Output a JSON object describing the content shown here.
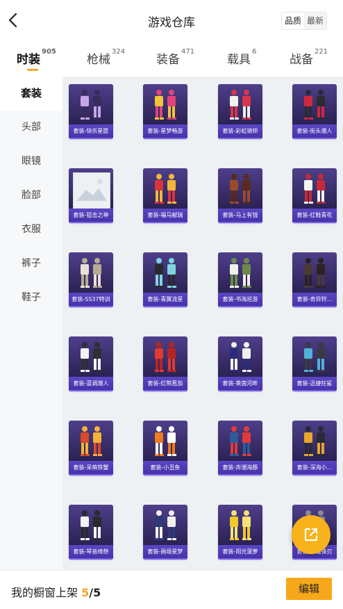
{
  "header": {
    "title": "游戏仓库",
    "sort_options": [
      "品质",
      "最新"
    ],
    "active_sort": "品质"
  },
  "tabs": [
    {
      "label": "时装",
      "count": "905",
      "active": true
    },
    {
      "label": "枪械",
      "count": "324",
      "active": false
    },
    {
      "label": "装备",
      "count": "471",
      "active": false
    },
    {
      "label": "载具",
      "count": "6",
      "active": false
    },
    {
      "label": "战备",
      "count": "221",
      "active": false
    }
  ],
  "sidebar": {
    "items": [
      "套装",
      "头部",
      "眼镜",
      "脸部",
      "衣服",
      "裤子",
      "鞋子"
    ],
    "active": "套装"
  },
  "items": [
    {
      "name": "套装-快乐星愿",
      "palette": [
        "#c7a6e8",
        "#3a2c5c"
      ]
    },
    {
      "name": "套装-星梦畅游",
      "palette": [
        "#f3c33b",
        "#e0447a"
      ]
    },
    {
      "name": "套装-彩虹骑师",
      "palette": [
        "#f1f1f1",
        "#d8354a"
      ]
    },
    {
      "name": "套装-街头潮人",
      "palette": [
        "#d02740",
        "#2b2b33"
      ]
    },
    {
      "name": "套装-狙击之神",
      "palette": [
        "#eef1f4",
        "#cfd6de"
      ],
      "placeholder": true
    },
    {
      "name": "套装-福马献瑞",
      "palette": [
        "#d9343c",
        "#f3b63b"
      ]
    },
    {
      "name": "套装-马上有钱",
      "palette": [
        "#9a4a2b",
        "#5a2a1d"
      ]
    },
    {
      "name": "套装-红鞋青花",
      "palette": [
        "#f4f4f4",
        "#c9283b"
      ]
    },
    {
      "name": "套装-SS37特训",
      "palette": [
        "#e8e2d6",
        "#b8aa92"
      ]
    },
    {
      "name": "套装-青翼流星",
      "palette": [
        "#2a2a30",
        "#7fd3e0"
      ]
    },
    {
      "name": "套装-书海巡游",
      "palette": [
        "#f2f2ec",
        "#6b8a4a"
      ]
    },
    {
      "name": "套装-奇异狩...",
      "palette": [
        "#4a3a36",
        "#2b2222"
      ]
    },
    {
      "name": "套装-蓝调潮人",
      "palette": [
        "#f3f3f3",
        "#2f2f36"
      ]
    },
    {
      "name": "套装-红熊惹茄",
      "palette": [
        "#e23a2e",
        "#b82521"
      ]
    },
    {
      "name": "套装-莱茵河畔",
      "palette": [
        "#2a2d7a",
        "#f0f0f0"
      ]
    },
    {
      "name": "套装-迅捷狂鲨",
      "palette": [
        "#4fb3d6",
        "#3a3a44"
      ]
    },
    {
      "name": "套装-呆萌铁蟹",
      "palette": [
        "#d94a2a",
        "#f4b23a"
      ]
    },
    {
      "name": "套装-小丑鱼",
      "palette": [
        "#f07a1e",
        "#ffffff"
      ]
    },
    {
      "name": "套装-奔潮海豚",
      "palette": [
        "#2f5a9a",
        "#e23a3a"
      ]
    },
    {
      "name": "套装-深海小...",
      "palette": [
        "#e8a62a",
        "#2a2a36"
      ]
    },
    {
      "name": "套装-琴音绮想",
      "palette": [
        "#f2f2f2",
        "#2a2a30"
      ]
    },
    {
      "name": "套装-画境星梦",
      "palette": [
        "#2c3a78",
        "#f0f0f0"
      ]
    },
    {
      "name": "套装-阳光菠萝",
      "palette": [
        "#f3c728",
        "#f5e27a"
      ]
    },
    {
      "name": "套装-星耀锋刃",
      "palette": [
        "#3a3a44",
        "#8a8a96"
      ]
    }
  ],
  "bottom": {
    "label": "我的橱窗上架",
    "current": "5",
    "separator": "/",
    "total": "5",
    "edit_label": "编辑"
  },
  "icons": {
    "back": "chevron-left-icon",
    "fab": "external-share-icon"
  },
  "colors": {
    "accent": "#f5a623",
    "card_bg": "#2c2356",
    "card_label": "#4733a8"
  }
}
